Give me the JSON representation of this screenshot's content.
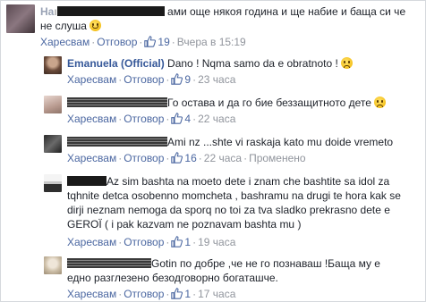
{
  "comments": [
    {
      "author_suffix": "",
      "text": "ами още някоя година и ще набие и баща си че не слуша",
      "like_label": "Харесвам",
      "reply_label": "Отговор",
      "likes": "19",
      "time": "Вчера в 15:19",
      "edited": ""
    },
    {
      "author": "Emanuela (Official)",
      "text": "Dano ! Nqma samo da e obratnoto !",
      "like_label": "Харесвам",
      "reply_label": "Отговор",
      "likes": "9",
      "time": "23 часа",
      "edited": ""
    },
    {
      "text": "Го остава и да го бие беззащитното дете",
      "like_label": "Харесвам",
      "reply_label": "Отговор",
      "likes": "4",
      "time": "22 часа",
      "edited": ""
    },
    {
      "text": "Ami nz ...shte vi raskaja kato mu doide vremeto",
      "like_label": "Харесвам",
      "reply_label": "Отговор",
      "likes": "16",
      "time": "22 часа",
      "edited": "Променено"
    },
    {
      "text_line1": "Az sim bashta na moeto dete i znam che bashtite sa idol",
      "text_rest": "za tqhnite detca osobenno momcheta , bashramu na drugi te hora kak se dirji neznam nemoga da sporq no toi za tva sladko prekrasno dete e GEROÏ ( i pak kazvam ne poznavam bashta mu )",
      "like_label": "Харесвам",
      "reply_label": "Отговор",
      "likes": "1",
      "time": "19 часа",
      "edited": ""
    },
    {
      "text_line1": "Gotin по добре ,че не го познаваш !Баща му е",
      "text_rest": "едно разглезено безодговорно богаташче.",
      "like_label": "Харесвам",
      "reply_label": "Отговор",
      "likes": "1",
      "time": "17 часа",
      "edited": ""
    }
  ],
  "colors": {
    "link": "#4b67a1",
    "author": "#365899",
    "meta": "#90949c",
    "text": "#1d2129"
  },
  "icons": [
    "thumbs-up-icon",
    "smile-emoji-icon",
    "frown-emoji-icon"
  ]
}
